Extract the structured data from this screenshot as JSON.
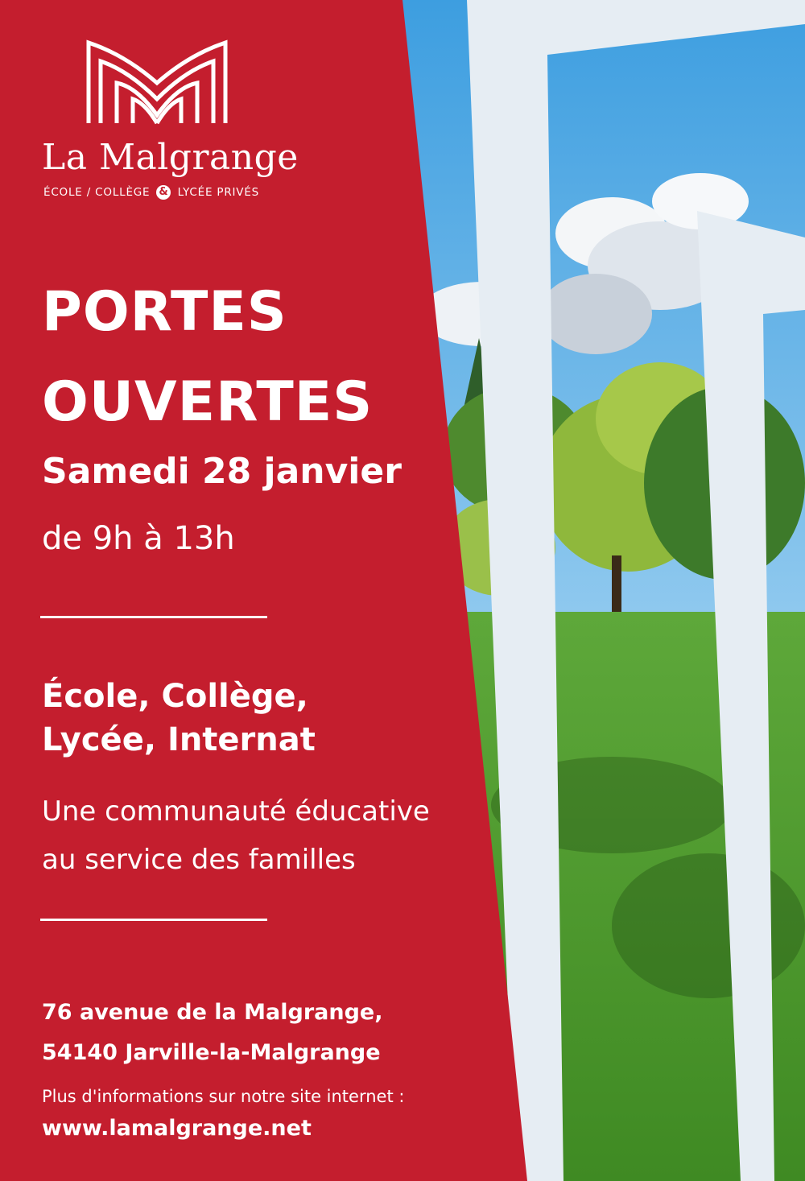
{
  "logo": {
    "name": "La Malgrange",
    "sub_left": "ÉCOLE / COLLÈGE",
    "sub_amp": "&",
    "sub_right": "LYCÉE PRIVÉS"
  },
  "headline": {
    "line1": "PORTES",
    "line2": "OUVERTES",
    "date": "Samedi 28 janvier",
    "hours": "de 9h à 13h"
  },
  "levels": {
    "line1": "École, Collège,",
    "line2": "Lycée, Internat"
  },
  "tagline": {
    "line1": "Une communauté éducative",
    "line2": "au service des familles"
  },
  "address": {
    "line1": "76 avenue de la Malgrange,",
    "line2": "54140 Jarville-la-Malgrange"
  },
  "contact": {
    "info": "Plus d'informations sur notre site internet :",
    "url": "www.lamalgrange.net"
  },
  "colors": {
    "brand_red": "#c41e2e",
    "text": "#ffffff",
    "frame": "#e6edf3"
  }
}
